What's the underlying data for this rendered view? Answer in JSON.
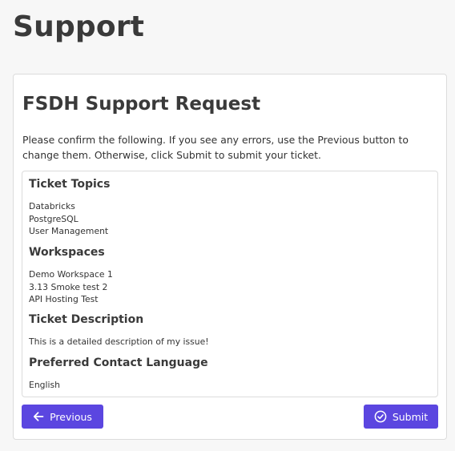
{
  "page": {
    "title": "Support"
  },
  "form": {
    "title": "FSDH Support Request",
    "instructions": "Please confirm the following. If you see any errors, use the Previous button to change them. Otherwise, click Submit to submit your ticket."
  },
  "summary": {
    "ticket_topics": {
      "heading": "Ticket Topics",
      "items": [
        "Databricks",
        "PostgreSQL",
        "User Management"
      ]
    },
    "workspaces": {
      "heading": "Workspaces",
      "items": [
        "Demo Workspace 1",
        "3.13 Smoke test 2",
        "API Hosting Test"
      ]
    },
    "ticket_description": {
      "heading": "Ticket Description",
      "value": "This is a detailed description of my issue!"
    },
    "contact_language": {
      "heading": "Preferred Contact Language",
      "value": "English"
    }
  },
  "actions": {
    "previous_label": "Previous",
    "previous_icon": "arrow-left-icon",
    "submit_label": "Submit",
    "submit_icon": "check-circle-icon"
  },
  "colors": {
    "accent": "#5b46e0",
    "background": "#f7f7f7",
    "card": "#ffffff",
    "border": "#dcdcdc"
  }
}
